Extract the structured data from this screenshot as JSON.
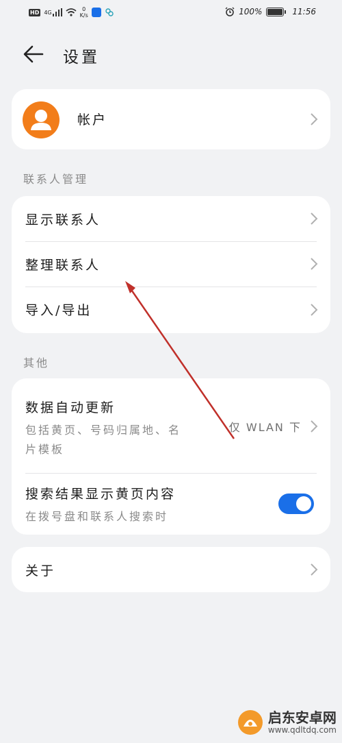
{
  "status_bar": {
    "network": "HD",
    "signal_type": "4G",
    "speed_value": "0",
    "speed_unit": "K/s",
    "battery": "100%",
    "time": "11:56"
  },
  "header": {
    "title": "设置"
  },
  "account": {
    "label": "帐户"
  },
  "contacts_section": {
    "title": "联系人管理",
    "items": [
      {
        "label": "显示联系人"
      },
      {
        "label": "整理联系人"
      },
      {
        "label": "导入/导出"
      }
    ]
  },
  "other_section": {
    "title": "其他",
    "auto_update": {
      "label": "数据自动更新",
      "description_line1": "包括黄页、号码归属地、名",
      "description_line2": "片模板",
      "value": "仅 WLAN 下"
    },
    "yellow_pages": {
      "label": "搜索结果显示黄页内容",
      "description": "在拨号盘和联系人搜索时",
      "enabled": true
    }
  },
  "about": {
    "label": "关于"
  },
  "watermark": {
    "name": "启东安卓网",
    "url": "www.qdltdq.com"
  },
  "colors": {
    "accent": "#1a6fe8",
    "avatar": "#f27d1a",
    "annotation": "#c0302a"
  }
}
